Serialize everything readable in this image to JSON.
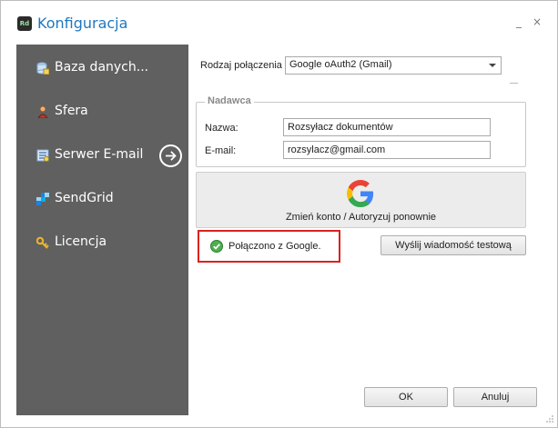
{
  "window": {
    "title": "Konfiguracja",
    "app_icon_text": "Rd",
    "minimize_glyph": "_",
    "close_glyph": "×"
  },
  "sidebar": {
    "items": [
      {
        "label": "Baza danych...",
        "icon": "database-icon"
      },
      {
        "label": "Sfera",
        "icon": "user-icon"
      },
      {
        "label": "Serwer E-mail",
        "icon": "email-server-icon",
        "active": true
      },
      {
        "label": "SendGrid",
        "icon": "sendgrid-icon"
      },
      {
        "label": "Licencja",
        "icon": "key-icon"
      }
    ],
    "active_indicator_icon": "arrow-right-circle-icon"
  },
  "connection": {
    "label": "Rodzaj połączenia",
    "selected": "Google oAuth2 (Gmail)"
  },
  "sender": {
    "legend": "Nadawca",
    "name_label": "Nazwa:",
    "name_value": "Rozsyłacz dokumentów",
    "email_label": "E-mail:",
    "email_value": "rozsylacz@gmail.com"
  },
  "google_button": {
    "label": "Zmień konto / Autoryzuj ponownie",
    "icon": "google-logo-icon"
  },
  "status": {
    "text": "Połączono z Google.",
    "icon": "check-circle-icon"
  },
  "buttons": {
    "send_test": "Wyślij wiadomość testową",
    "ok": "OK",
    "cancel": "Anuluj"
  },
  "colors": {
    "sidebar_bg": "#606060",
    "title": "#1f77c0",
    "status_border": "#d9221f",
    "status_ok": "#4caf50"
  }
}
